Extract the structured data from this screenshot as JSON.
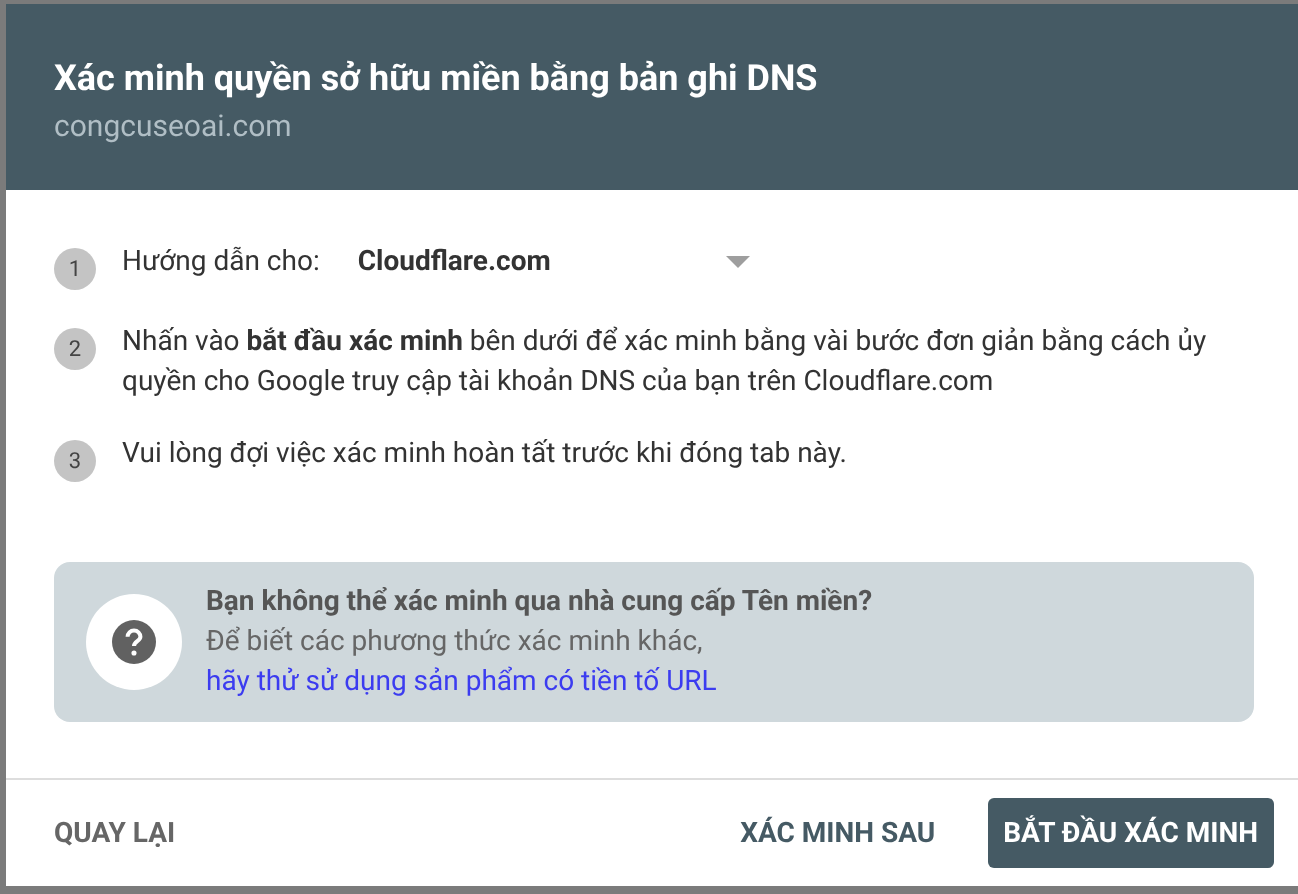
{
  "dialog": {
    "title": "Xác minh quyền sở hữu miền bằng bản ghi DNS",
    "subtitle": "congcuseoai.com"
  },
  "steps": [
    {
      "number": "1",
      "kind": "select",
      "label": "Hướng dẫn cho:",
      "value": "Cloudflare.com"
    },
    {
      "number": "2",
      "kind": "text",
      "text": "Nhấn vào **bắt đầu xác minh** bên dưới để xác minh bằng vài bước đơn giản bằng cách ủy quyền cho Google truy cập tài khoản DNS của bạn trên Cloudflare.com"
    },
    {
      "number": "3",
      "kind": "text",
      "text": "Vui lòng đợi việc xác minh hoàn tất trước khi đóng tab này."
    }
  ],
  "info": {
    "title": "Bạn không thể xác minh qua nhà cung cấp Tên miền?",
    "text": "Để biết các phương thức xác minh khác,",
    "link": "hãy thử sử dụng sản phẩm có tiền tố URL"
  },
  "buttons": [
    {
      "label": "QUAY LẠI",
      "kind": "text"
    },
    {
      "label": "XÁC MINH SAU",
      "kind": "text"
    },
    {
      "label": "BẮT ĐẦU XÁC MINH",
      "kind": "primary"
    }
  ]
}
